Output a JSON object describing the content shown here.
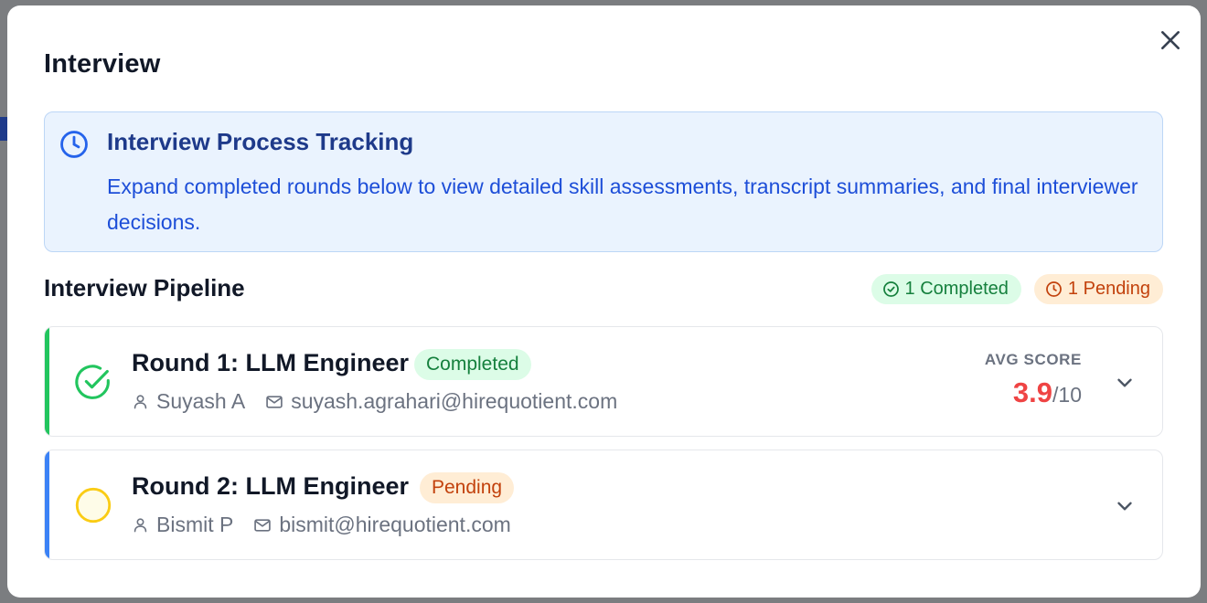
{
  "modal": {
    "title": "Interview"
  },
  "info": {
    "title": "Interview Process Tracking",
    "description": "Expand completed rounds below to view detailed skill assessments, transcript summaries, and final interviewer decisions."
  },
  "pipeline": {
    "title": "Interview Pipeline",
    "completed_badge": "1 Completed",
    "pending_badge": "1 Pending"
  },
  "rounds": [
    {
      "title": "Round 1: LLM Engineer",
      "status": "Completed",
      "interviewer": "Suyash A",
      "email": "suyash.agrahari@hirequotient.com",
      "score_label": "AVG SCORE",
      "score": "3.9",
      "score_max": "/10"
    },
    {
      "title": "Round 2: LLM Engineer",
      "status": "Pending",
      "interviewer": "Bismit P",
      "email": "bismit@hirequotient.com"
    }
  ],
  "colors": {
    "completed_accent": "#22c55e",
    "pending_accent": "#3b82f6",
    "pending_circle": "#facc15",
    "score": "#ef4444",
    "info_bg": "#eaf3fe"
  },
  "icons": {
    "close": "close-icon",
    "info": "clock-icon",
    "completed_round": "check-circle-icon",
    "pending_round": "pending-circle-icon",
    "person": "user-icon",
    "mail": "mail-icon",
    "expand": "chevron-down-icon"
  }
}
